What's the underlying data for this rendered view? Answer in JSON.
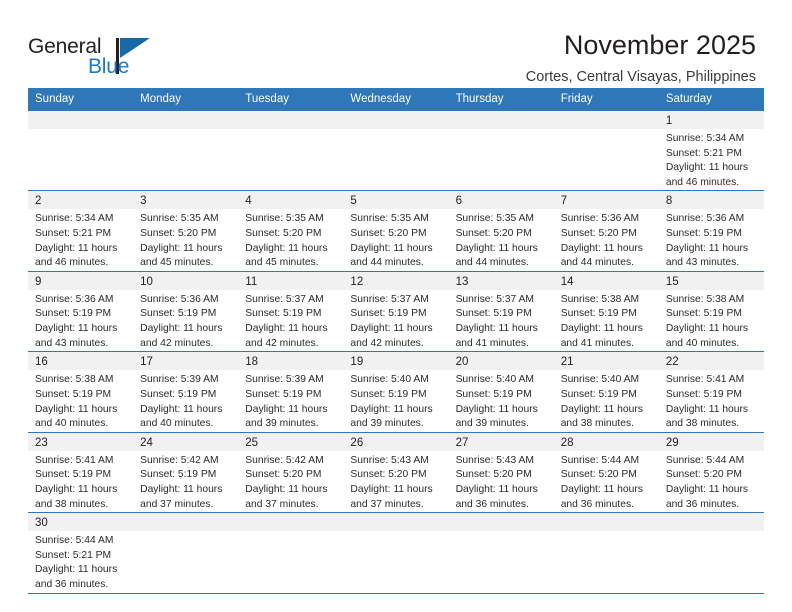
{
  "brand": {
    "name_top": "General",
    "name_bottom": "Blue",
    "accent_color": "#1f7ac4",
    "header_blue": "#2e77b8"
  },
  "header": {
    "title": "November 2025",
    "subtitle": "Cortes, Central Visayas, Philippines"
  },
  "calendar": {
    "weekdays": [
      "Sunday",
      "Monday",
      "Tuesday",
      "Wednesday",
      "Thursday",
      "Friday",
      "Saturday"
    ],
    "weeks": [
      [
        {
          "day": "",
          "empty": true
        },
        {
          "day": "",
          "empty": true
        },
        {
          "day": "",
          "empty": true
        },
        {
          "day": "",
          "empty": true
        },
        {
          "day": "",
          "empty": true
        },
        {
          "day": "",
          "empty": true
        },
        {
          "day": "1",
          "sunrise": "Sunrise: 5:34 AM",
          "sunset": "Sunset: 5:21 PM",
          "daylight1": "Daylight: 11 hours",
          "daylight2": "and 46 minutes."
        }
      ],
      [
        {
          "day": "2",
          "sunrise": "Sunrise: 5:34 AM",
          "sunset": "Sunset: 5:21 PM",
          "daylight1": "Daylight: 11 hours",
          "daylight2": "and 46 minutes."
        },
        {
          "day": "3",
          "sunrise": "Sunrise: 5:35 AM",
          "sunset": "Sunset: 5:20 PM",
          "daylight1": "Daylight: 11 hours",
          "daylight2": "and 45 minutes."
        },
        {
          "day": "4",
          "sunrise": "Sunrise: 5:35 AM",
          "sunset": "Sunset: 5:20 PM",
          "daylight1": "Daylight: 11 hours",
          "daylight2": "and 45 minutes."
        },
        {
          "day": "5",
          "sunrise": "Sunrise: 5:35 AM",
          "sunset": "Sunset: 5:20 PM",
          "daylight1": "Daylight: 11 hours",
          "daylight2": "and 44 minutes."
        },
        {
          "day": "6",
          "sunrise": "Sunrise: 5:35 AM",
          "sunset": "Sunset: 5:20 PM",
          "daylight1": "Daylight: 11 hours",
          "daylight2": "and 44 minutes."
        },
        {
          "day": "7",
          "sunrise": "Sunrise: 5:36 AM",
          "sunset": "Sunset: 5:20 PM",
          "daylight1": "Daylight: 11 hours",
          "daylight2": "and 44 minutes."
        },
        {
          "day": "8",
          "sunrise": "Sunrise: 5:36 AM",
          "sunset": "Sunset: 5:19 PM",
          "daylight1": "Daylight: 11 hours",
          "daylight2": "and 43 minutes."
        }
      ],
      [
        {
          "day": "9",
          "sunrise": "Sunrise: 5:36 AM",
          "sunset": "Sunset: 5:19 PM",
          "daylight1": "Daylight: 11 hours",
          "daylight2": "and 43 minutes."
        },
        {
          "day": "10",
          "sunrise": "Sunrise: 5:36 AM",
          "sunset": "Sunset: 5:19 PM",
          "daylight1": "Daylight: 11 hours",
          "daylight2": "and 42 minutes."
        },
        {
          "day": "11",
          "sunrise": "Sunrise: 5:37 AM",
          "sunset": "Sunset: 5:19 PM",
          "daylight1": "Daylight: 11 hours",
          "daylight2": "and 42 minutes."
        },
        {
          "day": "12",
          "sunrise": "Sunrise: 5:37 AM",
          "sunset": "Sunset: 5:19 PM",
          "daylight1": "Daylight: 11 hours",
          "daylight2": "and 42 minutes."
        },
        {
          "day": "13",
          "sunrise": "Sunrise: 5:37 AM",
          "sunset": "Sunset: 5:19 PM",
          "daylight1": "Daylight: 11 hours",
          "daylight2": "and 41 minutes."
        },
        {
          "day": "14",
          "sunrise": "Sunrise: 5:38 AM",
          "sunset": "Sunset: 5:19 PM",
          "daylight1": "Daylight: 11 hours",
          "daylight2": "and 41 minutes."
        },
        {
          "day": "15",
          "sunrise": "Sunrise: 5:38 AM",
          "sunset": "Sunset: 5:19 PM",
          "daylight1": "Daylight: 11 hours",
          "daylight2": "and 40 minutes."
        }
      ],
      [
        {
          "day": "16",
          "sunrise": "Sunrise: 5:38 AM",
          "sunset": "Sunset: 5:19 PM",
          "daylight1": "Daylight: 11 hours",
          "daylight2": "and 40 minutes."
        },
        {
          "day": "17",
          "sunrise": "Sunrise: 5:39 AM",
          "sunset": "Sunset: 5:19 PM",
          "daylight1": "Daylight: 11 hours",
          "daylight2": "and 40 minutes."
        },
        {
          "day": "18",
          "sunrise": "Sunrise: 5:39 AM",
          "sunset": "Sunset: 5:19 PM",
          "daylight1": "Daylight: 11 hours",
          "daylight2": "and 39 minutes."
        },
        {
          "day": "19",
          "sunrise": "Sunrise: 5:40 AM",
          "sunset": "Sunset: 5:19 PM",
          "daylight1": "Daylight: 11 hours",
          "daylight2": "and 39 minutes."
        },
        {
          "day": "20",
          "sunrise": "Sunrise: 5:40 AM",
          "sunset": "Sunset: 5:19 PM",
          "daylight1": "Daylight: 11 hours",
          "daylight2": "and 39 minutes."
        },
        {
          "day": "21",
          "sunrise": "Sunrise: 5:40 AM",
          "sunset": "Sunset: 5:19 PM",
          "daylight1": "Daylight: 11 hours",
          "daylight2": "and 38 minutes."
        },
        {
          "day": "22",
          "sunrise": "Sunrise: 5:41 AM",
          "sunset": "Sunset: 5:19 PM",
          "daylight1": "Daylight: 11 hours",
          "daylight2": "and 38 minutes."
        }
      ],
      [
        {
          "day": "23",
          "sunrise": "Sunrise: 5:41 AM",
          "sunset": "Sunset: 5:19 PM",
          "daylight1": "Daylight: 11 hours",
          "daylight2": "and 38 minutes."
        },
        {
          "day": "24",
          "sunrise": "Sunrise: 5:42 AM",
          "sunset": "Sunset: 5:19 PM",
          "daylight1": "Daylight: 11 hours",
          "daylight2": "and 37 minutes."
        },
        {
          "day": "25",
          "sunrise": "Sunrise: 5:42 AM",
          "sunset": "Sunset: 5:20 PM",
          "daylight1": "Daylight: 11 hours",
          "daylight2": "and 37 minutes."
        },
        {
          "day": "26",
          "sunrise": "Sunrise: 5:43 AM",
          "sunset": "Sunset: 5:20 PM",
          "daylight1": "Daylight: 11 hours",
          "daylight2": "and 37 minutes."
        },
        {
          "day": "27",
          "sunrise": "Sunrise: 5:43 AM",
          "sunset": "Sunset: 5:20 PM",
          "daylight1": "Daylight: 11 hours",
          "daylight2": "and 36 minutes."
        },
        {
          "day": "28",
          "sunrise": "Sunrise: 5:44 AM",
          "sunset": "Sunset: 5:20 PM",
          "daylight1": "Daylight: 11 hours",
          "daylight2": "and 36 minutes."
        },
        {
          "day": "29",
          "sunrise": "Sunrise: 5:44 AM",
          "sunset": "Sunset: 5:20 PM",
          "daylight1": "Daylight: 11 hours",
          "daylight2": "and 36 minutes."
        }
      ],
      [
        {
          "day": "30",
          "sunrise": "Sunrise: 5:44 AM",
          "sunset": "Sunset: 5:21 PM",
          "daylight1": "Daylight: 11 hours",
          "daylight2": "and 36 minutes."
        },
        {
          "day": "",
          "empty": true
        },
        {
          "day": "",
          "empty": true
        },
        {
          "day": "",
          "empty": true
        },
        {
          "day": "",
          "empty": true
        },
        {
          "day": "",
          "empty": true
        },
        {
          "day": "",
          "empty": true
        }
      ]
    ]
  }
}
